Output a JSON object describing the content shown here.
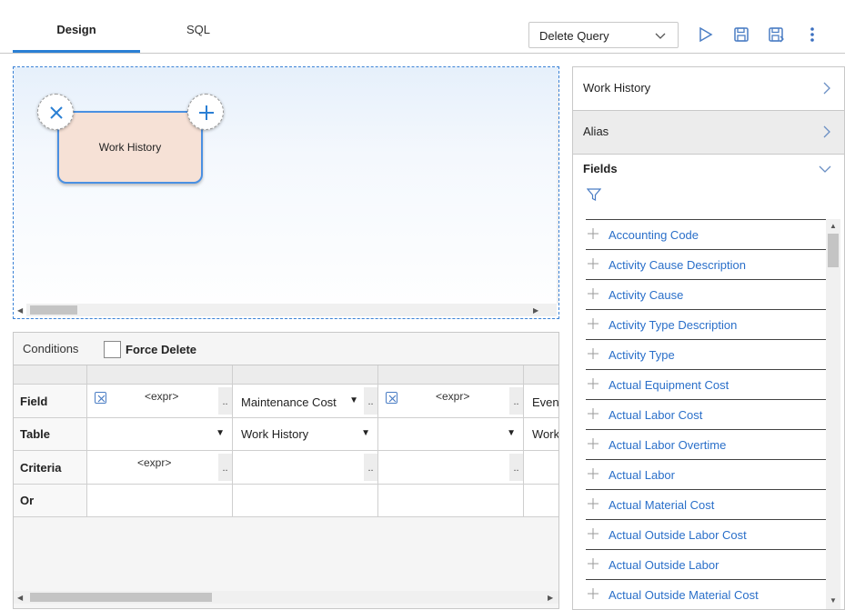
{
  "tabs": [
    {
      "label": "Design",
      "active": true
    },
    {
      "label": "SQL",
      "active": false
    }
  ],
  "toolbar": {
    "query_type": "Delete Query",
    "run_icon": "play-icon",
    "save_icon": "save-icon",
    "save_as_icon": "save-as-icon",
    "more_icon": "more-vertical-icon"
  },
  "canvas": {
    "node_label": "Work History",
    "accent": "#4a90e2",
    "node_fill": "#f6e1d6"
  },
  "conditions": {
    "title": "Conditions",
    "force_delete_label": "Force Delete",
    "force_delete_checked": false,
    "row_labels": [
      "Field",
      "Table",
      "Criteria",
      "Or"
    ],
    "columns": [
      {
        "field": "<expr>",
        "field_is_expr": true,
        "table": "",
        "criteria": "<expr>"
      },
      {
        "field": "Maintenance Cost",
        "field_is_expr": false,
        "table": "Work History",
        "criteria": ""
      },
      {
        "field": "<expr>",
        "field_is_expr": true,
        "table": "",
        "criteria": ""
      },
      {
        "field": "Event",
        "field_is_expr": false,
        "table": "Work",
        "criteria": ""
      }
    ],
    "dots": ".."
  },
  "right_panel": {
    "source_label": "Work History",
    "alias_label": "Alias",
    "fields_label": "Fields",
    "fields": [
      "Accounting Code",
      "Activity Cause Description",
      "Activity Cause",
      "Activity Type Description",
      "Activity Type",
      "Actual Equipment Cost",
      "Actual Labor Cost",
      "Actual Labor Overtime",
      "Actual Labor",
      "Actual Material Cost",
      "Actual Outside Labor Cost",
      "Actual Outside Labor",
      "Actual Outside Material Cost"
    ],
    "link_color": "#2a6fc9"
  }
}
